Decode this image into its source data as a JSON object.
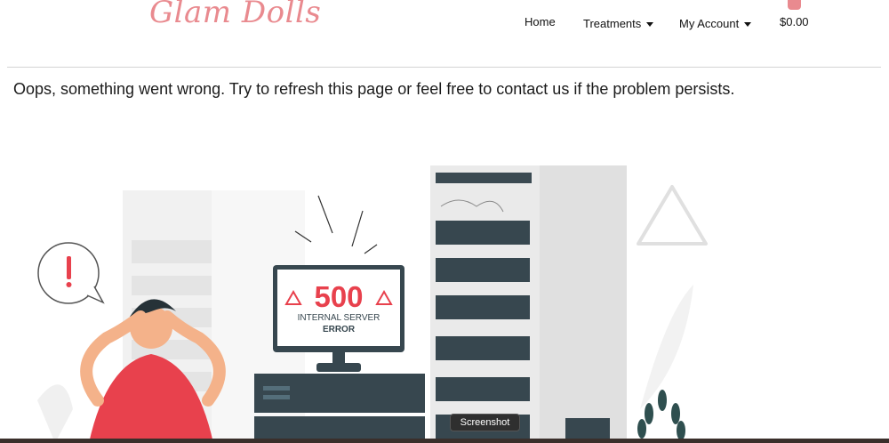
{
  "header": {
    "logo": "Glam Dolls",
    "nav": {
      "home": "Home",
      "treatments": "Treatments",
      "account": "My Account"
    },
    "cart": {
      "total": "$0.00",
      "icon": "shopping-bag-icon"
    }
  },
  "main": {
    "message": "Oops, something went wrong. Try to refresh this page or feel free to contact us if the problem persists."
  },
  "illustration": {
    "code": "500",
    "line1": "INTERNAL SERVER",
    "line2": "ERROR"
  },
  "tooltip": {
    "label": "Screenshot"
  },
  "colors": {
    "accent": "#e98a8f",
    "alert": "#e8414d",
    "server": "#37474f"
  }
}
